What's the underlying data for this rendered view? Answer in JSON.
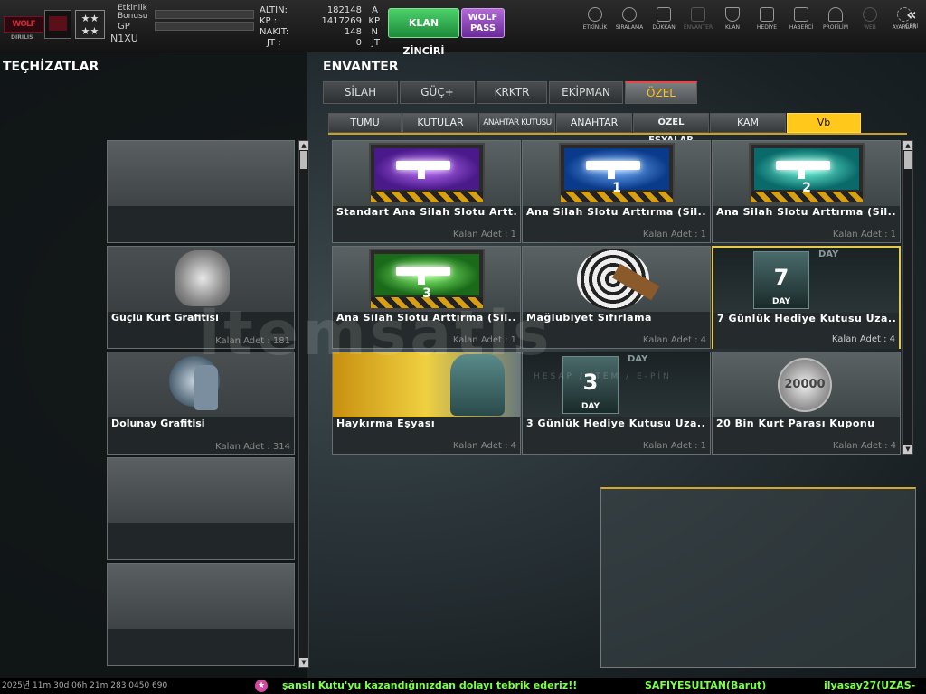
{
  "header": {
    "etkinlik_label": "Etkinlik Bonusu",
    "gp_label": "GP",
    "username": "N1XU",
    "currency": [
      {
        "label": "ALTIN:",
        "value": "182148",
        "unit": "A"
      },
      {
        "label": "KP :",
        "value": "1417269",
        "unit": "KP"
      },
      {
        "label": "NAKIT:",
        "value": "148",
        "unit": "N"
      },
      {
        "label": "JT :",
        "value": "0",
        "unit": "JT"
      }
    ],
    "klan_zinciri_label": "KLAN ZİNCİRİ",
    "wolf_pass_label": "WOLF PASS",
    "nav": [
      {
        "label": "ETKİNLİK",
        "icon": "stopwatch-icon"
      },
      {
        "label": "SIRALAMA",
        "icon": "medal-icon"
      },
      {
        "label": "DÜKKAN",
        "icon": "cart-icon"
      },
      {
        "label": "ENVANTER",
        "icon": "inventory-icon"
      },
      {
        "label": "KLAN",
        "icon": "shield-icon"
      },
      {
        "label": "HEDİYE",
        "icon": "gift-icon"
      },
      {
        "label": "HABERCİ",
        "icon": "megaphone-icon"
      },
      {
        "label": "PROFİLİM",
        "icon": "profile-icon"
      },
      {
        "label": "WEB",
        "icon": "globe-icon"
      },
      {
        "label": "AYARLAR",
        "icon": "gear-icon"
      }
    ],
    "geri_label": "GERİ"
  },
  "left": {
    "title": "TEÇHİZATLAR",
    "slots": [
      {
        "name": "",
        "qty": ""
      },
      {
        "name": "Güçlü Kurt Grafitisi",
        "qty": "Kalan Adet : 181"
      },
      {
        "name": "Dolunay Grafitisi",
        "qty": "Kalan Adet : 314"
      },
      {
        "name": "",
        "qty": ""
      },
      {
        "name": "",
        "qty": ""
      }
    ]
  },
  "inventory": {
    "title": "ENVANTER",
    "tabs": [
      "SİLAH",
      "GÜÇ+",
      "KRKTR",
      "EKİPMAN",
      "ÖZEL"
    ],
    "active_tab": "ÖZEL",
    "subtabs": [
      "TÜMÜ",
      "KUTULAR",
      "ANAHTAR KUTUSU",
      "ANAHTAR",
      "ÖZEL EŞYALAR",
      "KAM",
      "Vb"
    ],
    "active_subtab": "Vb",
    "items": [
      {
        "name": "Standart Ana Silah Slotu Artt...",
        "qty": "Kalan Adet : 1",
        "num": ""
      },
      {
        "name": "Ana Silah Slotu Arttırma (Sil...",
        "qty": "Kalan Adet : 1",
        "num": "1"
      },
      {
        "name": "Ana Silah Slotu Arttırma (Sil...",
        "qty": "Kalan Adet : 1",
        "num": "2"
      },
      {
        "name": "Ana Silah Slotu Arttırma (Sil...",
        "qty": "Kalan Adet : 1",
        "num": "3"
      },
      {
        "name": "Mağlubiyet Sıfırlama",
        "qty": "Kalan Adet : 4",
        "num": ""
      },
      {
        "name": "7 Günlük Hediye Kutusu Uza...",
        "qty": "Kalan Adet : 4",
        "num": "7",
        "day": "DAY"
      },
      {
        "name": "Haykırma Eşyası",
        "qty": "Kalan Adet : 4",
        "num": ""
      },
      {
        "name": "3 Günlük Hediye Kutusu Uza...",
        "qty": "Kalan Adet : 1",
        "num": "3",
        "day": "DAY"
      },
      {
        "name": "20 Bin Kurt Parası Kuponu",
        "qty": "Kalan Adet : 4",
        "num": "20000"
      }
    ]
  },
  "watermark": "itemsatis",
  "watermark_sub": "HESAP / İTEM / E-PİN",
  "ticker": {
    "left": "2025년 11m 30d 06h 21m 283 0450 690",
    "message": "şanslı Kutu'yu kazandığınızdan dolayı tebrik ederiz!!",
    "user1": "SAFİYESULTAN(Barut)",
    "user2": "ilyasay27(UZAS-"
  },
  "colors": {
    "accent": "#ffc81a",
    "klan": "#2ea84a",
    "wolf": "#9a4ac8",
    "ticker_text": "#7cff4a"
  }
}
